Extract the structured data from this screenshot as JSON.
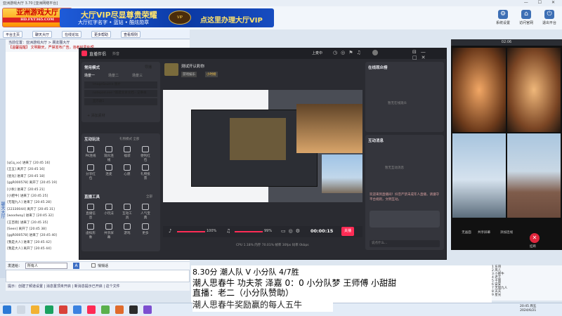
{
  "window": {
    "title": "亚洲游戏大厅 3.70 [亚洲网络平台]"
  },
  "banner": {
    "logo_main": "亚洲游戏大厅",
    "logo_sub": "HD.FXT365.COM",
    "vip_title": "大厅VIP尽显尊贵荣耀",
    "vip_sub": "大厅红字名字 • 蓝钻 • 酷炫勋章",
    "vip_cta": "点这里办理大厅VIP",
    "emblem": "VIP",
    "buttons": [
      {
        "label": "系统设置",
        "icon": "⚙"
      },
      {
        "label": "访问官网",
        "icon": "⌂"
      },
      {
        "label": "退出平台",
        "icon": "⏻"
      }
    ]
  },
  "toolbar": {
    "items": [
      "平台主页",
      "聊天大厅",
      "在线论坛",
      "更多帮助",
      "查看规则"
    ]
  },
  "room": {
    "breadcrumb": "当前位置：亚洲游戏大厅 > 朋友圈大厅",
    "marquee": "【温馨提醒】 文明聊天，严禁发布广告，违者封号处理",
    "side_label": "聊天大厅"
  },
  "chat": {
    "lines": [
      "[qCq_xx] 进来了 [20:45 16]",
      "[王五] 离开了 [20:45 16]",
      "[星光] 进来了 [20:45 18]",
      "[ggR000578] 离开了 [20:45 19]",
      "[小秋] 进来了 [20:45 21]",
      "[小肥牛] 进来了 [20:45 25]",
      "[无理九人] 进来了 [20:45 28]",
      "[22330044] 离开了 [20:45 31]",
      "[woodway] 进来了 [20:45 32]",
      "[王百晓] 进来了 [20:45 35]",
      "[Seen] 离开了 [20:45 38]",
      "[ggR000578] 进来了 [20:45 40]",
      "[我是大人] 进来了 [20:45 42]",
      "[我是大人] 离开了 [20:45 44]"
    ]
  },
  "input": {
    "label": "发送给：",
    "target": "所有人",
    "quiet": "悄悄话"
  },
  "statusbar": {
    "hint": "提示：创建了频道设置 | 消息置顶未开启 | 新消息提示已开启 | 这个文件"
  },
  "obs": {
    "title": "直播伴侣",
    "sub": "抖音",
    "live_btn": "上麦中",
    "scene_header": "常用模式",
    "scene_action": "导播",
    "scene_tabs": [
      "场景一",
      "场景二",
      "场景三"
    ],
    "sources": [
      "ImageSource 图片",
      "notepad.exe *新建文本文档 - 记事本",
      "显示器1"
    ],
    "add_source": "+ 添加素材",
    "interact_title": "互动玩法",
    "interact_hint": "礼物模式 全部",
    "tools_row1": [
      "PK连线",
      "观众连线",
      "福袋",
      "便利红包"
    ],
    "tools_row2": [
      "分享红包",
      "连麦",
      "心愿",
      "礼物投票"
    ],
    "ops_title": "直播工具",
    "ops_hint": "全部",
    "tools_row3": [
      "直播信息",
      "小玩法",
      "互动工具",
      "人气宝典"
    ],
    "tools_row4": [
      "虚拟形象",
      "共享屏幕",
      "游戏",
      "更多"
    ],
    "stream_name": "测试开认彩你",
    "stream_tag1": "游戏娱乐",
    "stream_tag2": "小时榜",
    "announce_title": "在线观众榜",
    "announce_empty": "暂无在线观众",
    "chat_title": "互动消息",
    "chat_empty": "暂无互动消息",
    "notice": "欢迎来到直播间！抖音严禁未成年人直播，请遵守平台规则，文明互动。",
    "chat_input": "说点什么...",
    "vol1": "100%",
    "vol2": "99%",
    "timer": "00:00:15",
    "timer_label": "关播",
    "status": "CPU 1.18%   内存 70.01%   帧率 30fps   码率 0kbps"
  },
  "cam": {
    "title": "02:06",
    "bottom_btns": [
      "无画面",
      "共享屏幕",
      "添加连线",
      "挂断"
    ]
  },
  "userlist": {
    "rows": [
      "1 东哥",
      "2 风儿",
      "3 小肥牛",
      "4 老王",
      "5 千面",
      "6 安安",
      "7 无理九人",
      "8 天天",
      "9 星光"
    ]
  },
  "announcement": {
    "line1": "8.30分                       潮人队 V 小分队            4/7胜",
    "line2": "潮人思春牛 功夫茶 泽嘉 0：0 小分队梦 王师傅 小甜甜",
    "line3": "直播：老二（小分队赞助）",
    "line4": "潮人思春牛奖励赢的每人五牛"
  },
  "clock": {
    "time": "20:45 周五",
    "date": "2024/6/21"
  },
  "colors": {
    "accent": "#1e5bd8",
    "obs_bg": "#2a2b31",
    "live_red": "#e0263c"
  }
}
